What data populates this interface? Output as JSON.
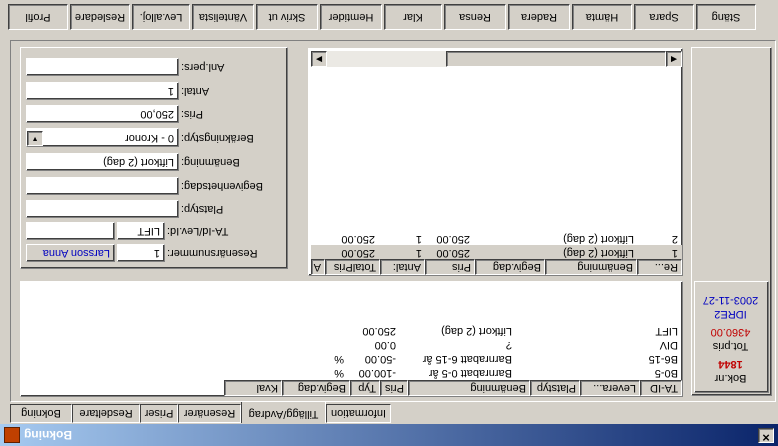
{
  "window": {
    "title": "Bokning",
    "close_glyph": "✕"
  },
  "toolbar": [
    "Profil",
    "Resledare",
    "Lev.alloj.",
    "Väntelista",
    "Skriv ut",
    "Hemtider",
    "Klar",
    "Rensa",
    "Radera",
    "Hämta",
    "Spara",
    "Stäng"
  ],
  "tabs": [
    "Bokning",
    "Resdeltare",
    "Priser",
    "Resenärer",
    "Tillägg/Avdrag",
    "Information"
  ],
  "active_tab": 4,
  "form": {
    "labels": {
      "anl_pers": "Anl.pers:",
      "antal": "Antal:",
      "pris": "Pris:",
      "berakningstyp": "Beräkningstyp:",
      "benamning": "Benämning:",
      "begivenhetsdag": "Begivenhetsdag:",
      "platstyp": "Platstyp:",
      "ta_id_lev_id": "TA-Id/Lev.Id:",
      "resenarsnummer": "Resenärsnummer:"
    },
    "values": {
      "anl_pers": "",
      "antal": "1",
      "pris": "250,00",
      "berakningstyp": "0 - Kronor",
      "benamning": "Liftkort (2 dag)",
      "begivenhetsdag": "",
      "platstyp": "",
      "ta_id": "LIFT",
      "lev_id": "",
      "resenarsnummer": "1",
      "resenar_namn": "Larsson Anna"
    }
  },
  "addon_grid": {
    "columns": [
      "Re...",
      "Benämning",
      "Begiv.dag",
      "Pris",
      "Antal:",
      "TotalPris",
      "A"
    ],
    "rows": [
      {
        "re": "1",
        "benamning": "Liftkort (2 dag)",
        "begivdag": "",
        "pris": "250.00",
        "antal": "1",
        "totalpris": "250.00"
      },
      {
        "re": "2",
        "benamning": "Liftkort (2 dag)",
        "begivdag": "",
        "pris": "250.00",
        "antal": "1",
        "totalpris": "250.00"
      }
    ]
  },
  "available_grid": {
    "columns": [
      "TA-ID",
      "Levera...",
      "Platstyp",
      "Benämning",
      "Pris",
      "Typ",
      "Begiv.dag",
      "Kval"
    ],
    "rows": [
      {
        "ta_id": "B0-5",
        "benamning": "Barnrabatt 0-5 år",
        "pris": "-100.00",
        "typ": "%"
      },
      {
        "ta_id": "B6-15",
        "benamning": "Barnrabatt 6-15 år",
        "pris": "-50.00",
        "typ": "%"
      },
      {
        "ta_id": "DIV",
        "benamning": "?",
        "pris": "0.00",
        "typ": ""
      },
      {
        "ta_id": "LIFT",
        "benamning": "Liftkort (2 dag)",
        "pris": "250.00",
        "typ": ""
      }
    ]
  },
  "summary": {
    "booking_label": "Bok.nr",
    "booking_number": "1844",
    "totpris_label": "Tot.pris",
    "totpris_value": "4360.00",
    "destination": "IDRE2",
    "date": "2003-11-27"
  },
  "colors": {
    "title_start": "#0a246a",
    "title_end": "#a6caf0",
    "blue_text": "#0000c0",
    "red_text": "#c00000"
  }
}
